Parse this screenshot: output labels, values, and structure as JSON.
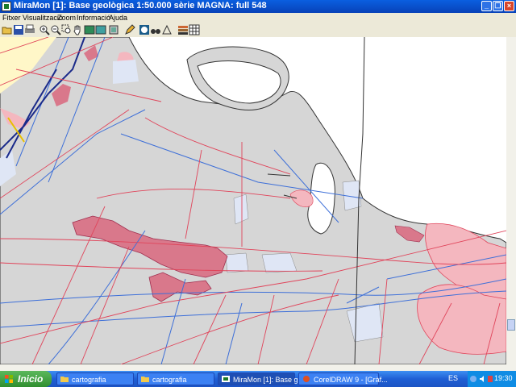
{
  "window": {
    "title": "MiraMon [1]:  Base geològica 1:50.000 sèrie MAGNA: full 548"
  },
  "menu": [
    "Fitxer",
    "Visualització",
    "Zoom",
    "Informació",
    "Ajuda"
  ],
  "toolbar": [
    "open-icon",
    "save-icon",
    "print-icon",
    "zoom-in-icon",
    "zoom-out-icon",
    "zoom-window-icon",
    "pan-hand-icon",
    "view-all-icon",
    "previous-view-icon",
    "layers-icon",
    "pencil-icon",
    "info-icon",
    "binoculars-icon",
    "query-icon",
    "legend-icon",
    "table-icon"
  ],
  "colors": {
    "map_fill": "#d6d6d6",
    "red_lines": "#e0445a",
    "blue_lines": "#3d6fd8",
    "pink_areas": "#d9788b",
    "light_pink": "#f4b7bf",
    "pale_blue": "#dfe6f5"
  },
  "taskbar": {
    "start": "Inicio",
    "tasks": [
      "cartografia",
      "cartografia",
      "MiraMon [1]:  Base g...",
      "CorelDRAW 9 - [Gràf..."
    ],
    "lang": "ES",
    "clock": "19:30"
  }
}
